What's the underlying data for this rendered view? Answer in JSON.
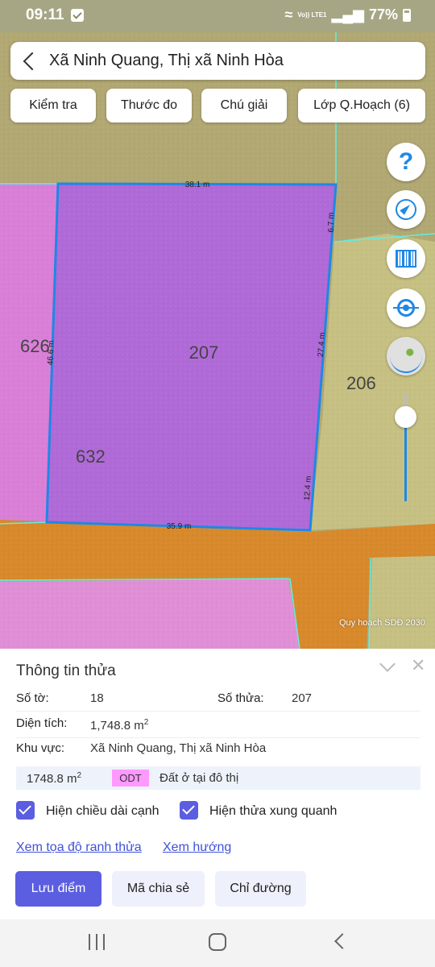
{
  "status_bar": {
    "time": "09:11",
    "network": "Vo)) LTE1",
    "battery": "77%"
  },
  "header": {
    "title": "Xã Ninh Quang, Thị xã Ninh Hòa"
  },
  "toolbar": {
    "check_label": "Kiểm tra",
    "measure_label": "Thước đo",
    "legend_label": "Chú giải",
    "layer_label": "Lớp Q.Hoạch (6)"
  },
  "map": {
    "attribution": "Quy hoạch SDĐ 2030",
    "parcels": {
      "selected": "207",
      "left": "626",
      "lower_left": "632",
      "right": "206"
    },
    "edges": {
      "top": "38.1 m",
      "top_right": "6.7 m",
      "right": "27.4 m",
      "bottom_right": "12.4 m",
      "bottom": "35.9 m",
      "left": "46.6 m"
    },
    "zoom_level": 0.8,
    "colors": {
      "residential": "#b06ad8",
      "agricultural": "#b2a873",
      "road": "#d8892b",
      "boundary": "#1e88e5"
    }
  },
  "panel": {
    "title": "Thông tin thửa",
    "sheet_label": "Số tờ:",
    "sheet_value": "18",
    "parcel_label": "Số thửa:",
    "parcel_value": "207",
    "area_label": "Diện tích:",
    "area_value": "1,748.8 m",
    "area_unit_sup": "2",
    "region_label": "Khu vực:",
    "region_value": "Xã Ninh Quang, Thị xã Ninh Hòa",
    "zone_area": "1748.8 m",
    "zone_area_sup": "2",
    "zone_code": "ODT",
    "zone_description": "Đất ở tại đô thị",
    "show_edge_lengths_label": "Hiện chiều dài cạnh",
    "show_neighbors_label": "Hiện thửa xung quanh",
    "link_coordinates": "Xem tọa độ ranh thửa",
    "link_direction": "Xem hướng",
    "save_point_label": "Lưu điểm",
    "share_code_label": "Mã chia sẻ",
    "directions_label": "Chỉ đường"
  }
}
